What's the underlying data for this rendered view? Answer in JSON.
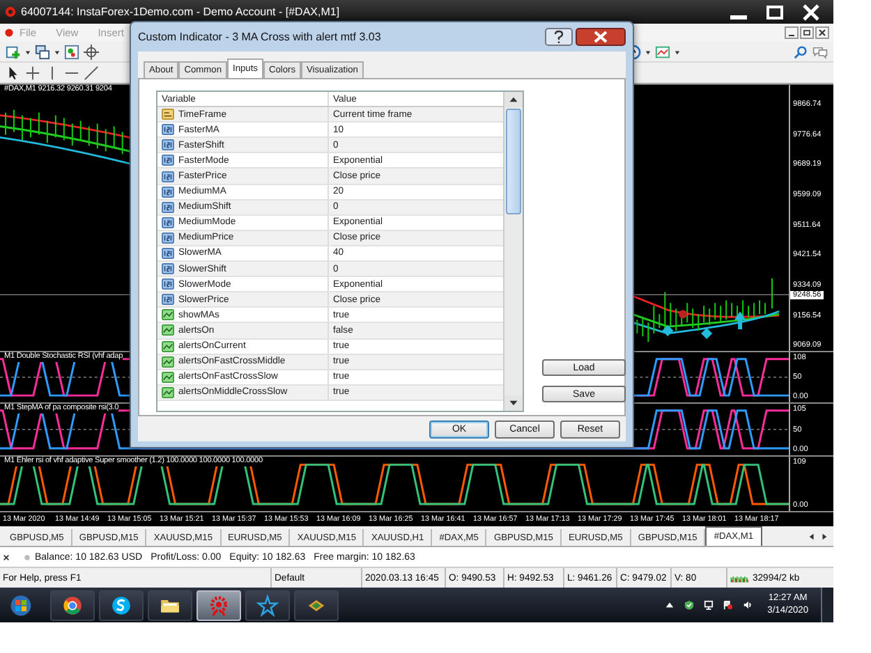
{
  "window": {
    "title": "64007144: InstaForex-1Demo.com - Demo Account - [#DAX,M1]"
  },
  "menu": [
    "File",
    "View",
    "Insert"
  ],
  "chart": {
    "header": "#DAX,M1 9216.32 9260.31 9204",
    "price_labels": [
      "9866.74",
      "9776.64",
      "9689.19",
      "9599.09",
      "9511.64",
      "9421.54",
      "9334.09",
      "9156.54",
      "9069.09"
    ],
    "current_price": "9248.56",
    "panes": [
      {
        "kind": "dual",
        "label": "M1 Double Stochastic RSI (vhf adap",
        "axis": [
          "108",
          "50",
          "0.00"
        ]
      },
      {
        "kind": "dual",
        "label": "M1 StepMA of pa composite rsi(3.0",
        "axis": [
          "105",
          "50",
          "0.00"
        ]
      },
      {
        "kind": "binary",
        "label": "M1 Ehler rsi of vhf adaptive Super smoother (1.2) 100.0000 100.0000 100.0000",
        "axis": [
          "109",
          "0.00"
        ]
      }
    ],
    "time_labels": [
      "13 Mar 2020",
      "13 Mar 14:49",
      "13 Mar 15:05",
      "13 Mar 15:21",
      "13 Mar 15:37",
      "13 Mar 15:53",
      "13 Mar 16:09",
      "13 Mar 16:25",
      "13 Mar 16:41",
      "13 Mar 16:57",
      "13 Mar 17:13",
      "13 Mar 17:29",
      "13 Mar 17:45",
      "13 Mar 18:01",
      "13 Mar 18:17"
    ]
  },
  "dialog": {
    "title": "Custom Indicator - 3 MA Cross with alert mtf 3.03",
    "tabs": [
      {
        "label": "About",
        "selected": false
      },
      {
        "label": "Common",
        "selected": false
      },
      {
        "label": "Inputs",
        "selected": true
      },
      {
        "label": "Colors",
        "selected": false
      },
      {
        "label": "Visualization",
        "selected": false
      }
    ],
    "columns": [
      "Variable",
      "Value"
    ],
    "rows": [
      {
        "kind": "text",
        "name": "TimeFrame",
        "value": "Current time frame"
      },
      {
        "kind": "number",
        "name": "FasterMA",
        "value": "10"
      },
      {
        "kind": "number",
        "name": "FasterShift",
        "value": "0"
      },
      {
        "kind": "number",
        "name": "FasterMode",
        "value": "Exponential"
      },
      {
        "kind": "number",
        "name": "FasterPrice",
        "value": "Close price"
      },
      {
        "kind": "number",
        "name": "MediumMA",
        "value": "20"
      },
      {
        "kind": "number",
        "name": "MediumShift",
        "value": "0"
      },
      {
        "kind": "number",
        "name": "MediumMode",
        "value": "Exponential"
      },
      {
        "kind": "number",
        "name": "MediumPrice",
        "value": "Close price"
      },
      {
        "kind": "number",
        "name": "SlowerMA",
        "value": "40"
      },
      {
        "kind": "number",
        "name": "SlowerShift",
        "value": "0"
      },
      {
        "kind": "number",
        "name": "SlowerMode",
        "value": "Exponential"
      },
      {
        "kind": "number",
        "name": "SlowerPrice",
        "value": "Close price"
      },
      {
        "kind": "bool",
        "name": "showMAs",
        "value": "true"
      },
      {
        "kind": "bool",
        "name": "alertsOn",
        "value": "false"
      },
      {
        "kind": "bool",
        "name": "alertsOnCurrent",
        "value": "true"
      },
      {
        "kind": "bool",
        "name": "alertsOnFastCrossMiddle",
        "value": "true"
      },
      {
        "kind": "bool",
        "name": "alertsOnFastCrossSlow",
        "value": "true"
      },
      {
        "kind": "bool",
        "name": "alertsOnMiddleCrossSlow",
        "value": "true"
      }
    ],
    "side_buttons": [
      "Load",
      "Save"
    ],
    "buttons": [
      "OK",
      "Cancel",
      "Reset"
    ]
  },
  "symbol_tabs": [
    {
      "label": "GBPUSD,M5",
      "selected": false
    },
    {
      "label": "GBPUSD,M15",
      "selected": false
    },
    {
      "label": "XAUUSD,M15",
      "selected": false
    },
    {
      "label": "EURUSD,M5",
      "selected": false
    },
    {
      "label": "XAUUSD,M15",
      "selected": false
    },
    {
      "label": "XAUUSD,H1",
      "selected": false
    },
    {
      "label": "#DAX,M5",
      "selected": false
    },
    {
      "label": "GBPUSD,M15",
      "selected": false
    },
    {
      "label": "EURUSD,M5",
      "selected": false
    },
    {
      "label": "GBPUSD,M15",
      "selected": false
    },
    {
      "label": "#DAX,M1",
      "selected": true
    }
  ],
  "account": [
    "Balance: 10 182.63 USD",
    "Profit/Loss: 0.00",
    "Equity: 10 182.63",
    "Free margin: 10 182.63"
  ],
  "status_bar": [
    "For Help, press F1",
    "Default",
    "2020.03.13 16:45",
    "O: 9490.53",
    "H: 9492.53",
    "L: 9461.26",
    "C: 9479.02",
    "V: 80",
    "32994/2 kb"
  ],
  "taskbar": {
    "apps": [
      {
        "kind": "start",
        "active": false
      },
      {
        "kind": "browser",
        "active": false
      },
      {
        "kind": "chat",
        "active": false
      },
      {
        "kind": "folder",
        "active": false
      },
      {
        "kind": "gear",
        "active": true
      },
      {
        "kind": "star",
        "active": false
      },
      {
        "kind": "box",
        "active": false
      }
    ],
    "time": "12:27 AM",
    "date": "3/14/2020"
  }
}
